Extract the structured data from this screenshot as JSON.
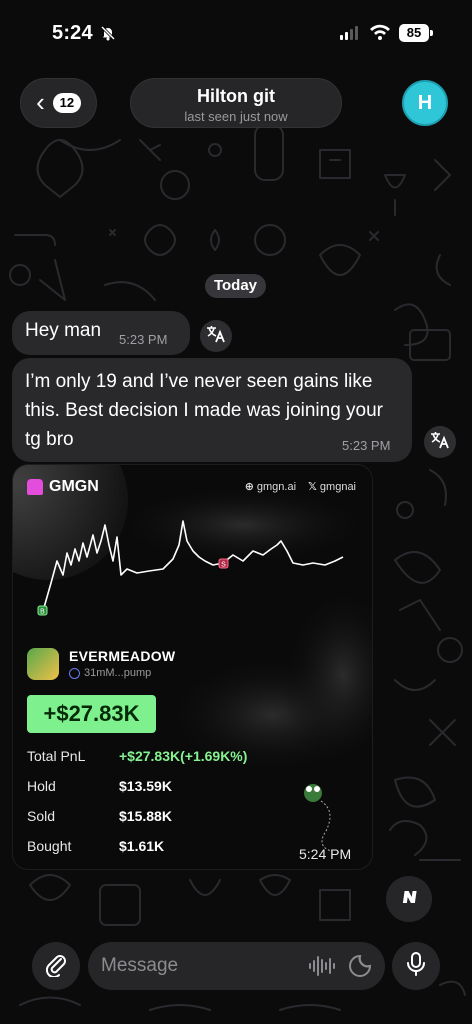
{
  "status_bar": {
    "time": "5:24",
    "battery": "85"
  },
  "header": {
    "back_count": "12",
    "contact_name": "Hilton git",
    "contact_status": "last seen just now",
    "avatar_initial": "H"
  },
  "date_separator": "Today",
  "messages": [
    {
      "text": "Hey man",
      "time": "5:23 PM"
    },
    {
      "text": "I’m only 19 and I’ve never seen gains like this. Best decision I made was joining your tg bro",
      "time": "5:23 PM"
    }
  ],
  "image_card": {
    "brand": "GMGN",
    "site": "gmgn.ai",
    "x_handle": "gmgnai",
    "token_name": "EVERMEADOW",
    "token_address": "31mM...pump",
    "pnl_badge": "+$27.83K",
    "stats": [
      {
        "label": "Total PnL",
        "value": "+$27.83K(+1.69K%)"
      },
      {
        "label": "Hold",
        "value": "$13.59K"
      },
      {
        "label": "Sold",
        "value": "$15.88K"
      },
      {
        "label": "Bought",
        "value": "$1.61K"
      }
    ],
    "time": "5:24 PM",
    "chart_markers": {
      "buy": "B",
      "sell": "S"
    }
  },
  "input": {
    "placeholder": "Message"
  },
  "icons": {
    "back": "chevron-left-icon",
    "translate": "translate-icon",
    "attach": "paperclip-icon",
    "voice_wave": "waveform-icon",
    "sticker": "sticker-icon",
    "mic": "microphone-icon",
    "scroll": "scroll-down-icon"
  },
  "colors": {
    "accent_avatar": "#2fc6d8",
    "pnl_green": "#7ef08d",
    "bubble": "#2a2a2d",
    "background": "#0b0b0c"
  }
}
